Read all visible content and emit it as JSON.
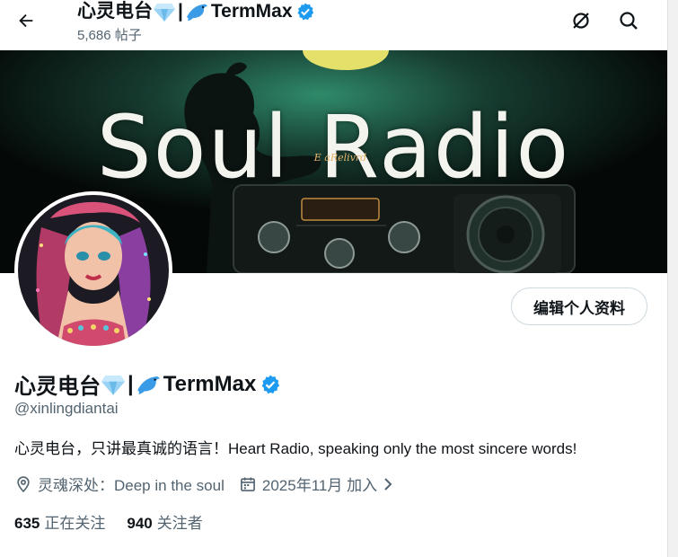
{
  "header": {
    "title_text": "心灵电台",
    "title_sep": "|",
    "title_brand": "TermMax",
    "post_count": "5,686 帖子"
  },
  "banner": {
    "text": "Soul Radio",
    "radio_label": "E aRelivrd"
  },
  "actions": {
    "edit_profile": "编辑个人资料"
  },
  "profile": {
    "name_text": "心灵电台",
    "name_sep": "|",
    "name_brand": "TermMax",
    "handle": "@xinlingdiantai",
    "bio": "心灵电台，只讲最真诚的语言！Heart Radio, speaking only the most sincere words!",
    "location": "灵魂深处：Deep in the soul",
    "joined": "2025年11月 加入"
  },
  "stats": {
    "following_count": "635",
    "following_label": "正在关注",
    "followers_count": "940",
    "followers_label": "关注者"
  },
  "icons": {
    "back": "arrow-left-icon",
    "grok": "grok-icon",
    "search": "search-icon",
    "verified": "verified-badge-icon",
    "location": "location-pin-icon",
    "calendar": "calendar-icon"
  },
  "colors": {
    "verified": "#1d9bf0",
    "muted": "#536471",
    "text": "#0f1419"
  }
}
